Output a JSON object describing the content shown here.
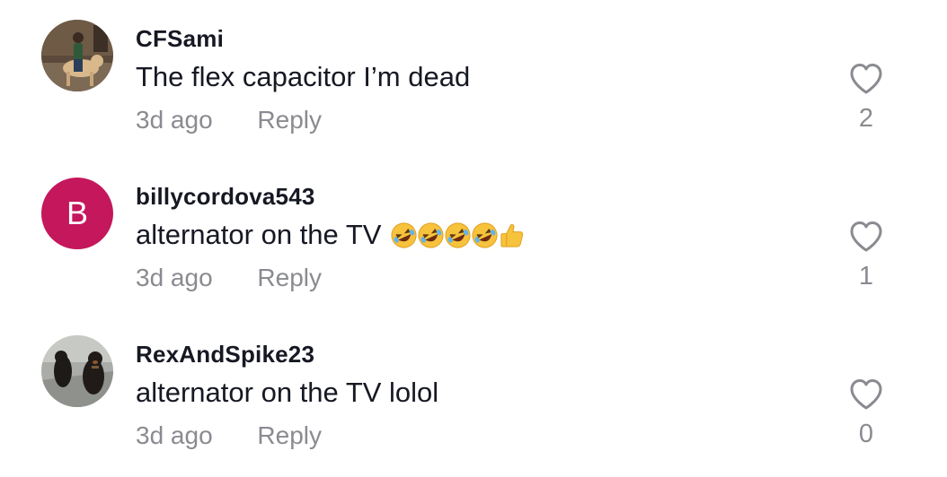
{
  "comments": [
    {
      "username": "CFSami",
      "text": "The flex capacitor I’m dead",
      "emojis": [],
      "time": "3d ago",
      "reply_label": "Reply",
      "likes": "2",
      "avatar": {
        "type": "photo",
        "icon": "person-riding-dog-photo"
      }
    },
    {
      "username": "billycordova543",
      "text": "alternator on the TV",
      "emojis": [
        "rolling-on-floor-laughing",
        "rolling-on-floor-laughing",
        "rolling-on-floor-laughing",
        "rolling-on-floor-laughing",
        "thumbs-up"
      ],
      "time": "3d ago",
      "reply_label": "Reply",
      "likes": "1",
      "avatar": {
        "type": "letter",
        "letter": "B",
        "color": "#c4175c"
      }
    },
    {
      "username": "RexAndSpike23",
      "text": "alternator on the TV lolol",
      "emojis": [],
      "time": "3d ago",
      "reply_label": "Reply",
      "likes": "0",
      "avatar": {
        "type": "photo",
        "icon": "two-dogs-photo"
      }
    }
  ],
  "colors": {
    "primary_text": "#161823",
    "secondary_text": "#8a8b91",
    "heart_outline": "#8a8b91",
    "letter_avatar_bg": "#c4175c"
  }
}
